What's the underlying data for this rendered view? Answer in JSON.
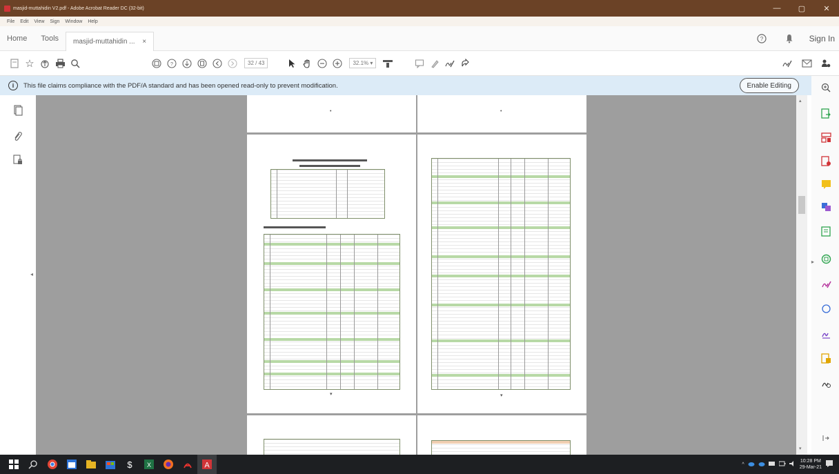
{
  "window": {
    "title": "masjid-muttahidin V2.pdf - Adobe Acrobat Reader DC (32-bit)",
    "minimize": "—",
    "maximize": "▢",
    "close": "✕"
  },
  "menu": [
    "File",
    "Edit",
    "View",
    "Sign",
    "Window",
    "Help"
  ],
  "tabs": {
    "home": "Home",
    "tools": "Tools",
    "document": "masjid-muttahidin ...",
    "document_close": "×",
    "sign_in": "Sign In"
  },
  "toolbar": {
    "page_current": "32",
    "page_total": "/ 43",
    "zoom": "32.1%"
  },
  "infobar": {
    "message": "This file claims compliance with the PDF/A standard and has been opened read-only to prevent modification.",
    "enable_editing": "Enable Editing"
  },
  "document": {
    "page_top_marks": [
      "•",
      "•"
    ]
  },
  "taskbar": {
    "time": "10:28 PM",
    "date": "29-Mar-21"
  },
  "colors": {
    "titlebar": "#6b4226",
    "infobar": "#dcebf7",
    "docbg": "#9e9e9e",
    "taskbar": "#1d1f22",
    "acrobat_red": "#d13438"
  }
}
